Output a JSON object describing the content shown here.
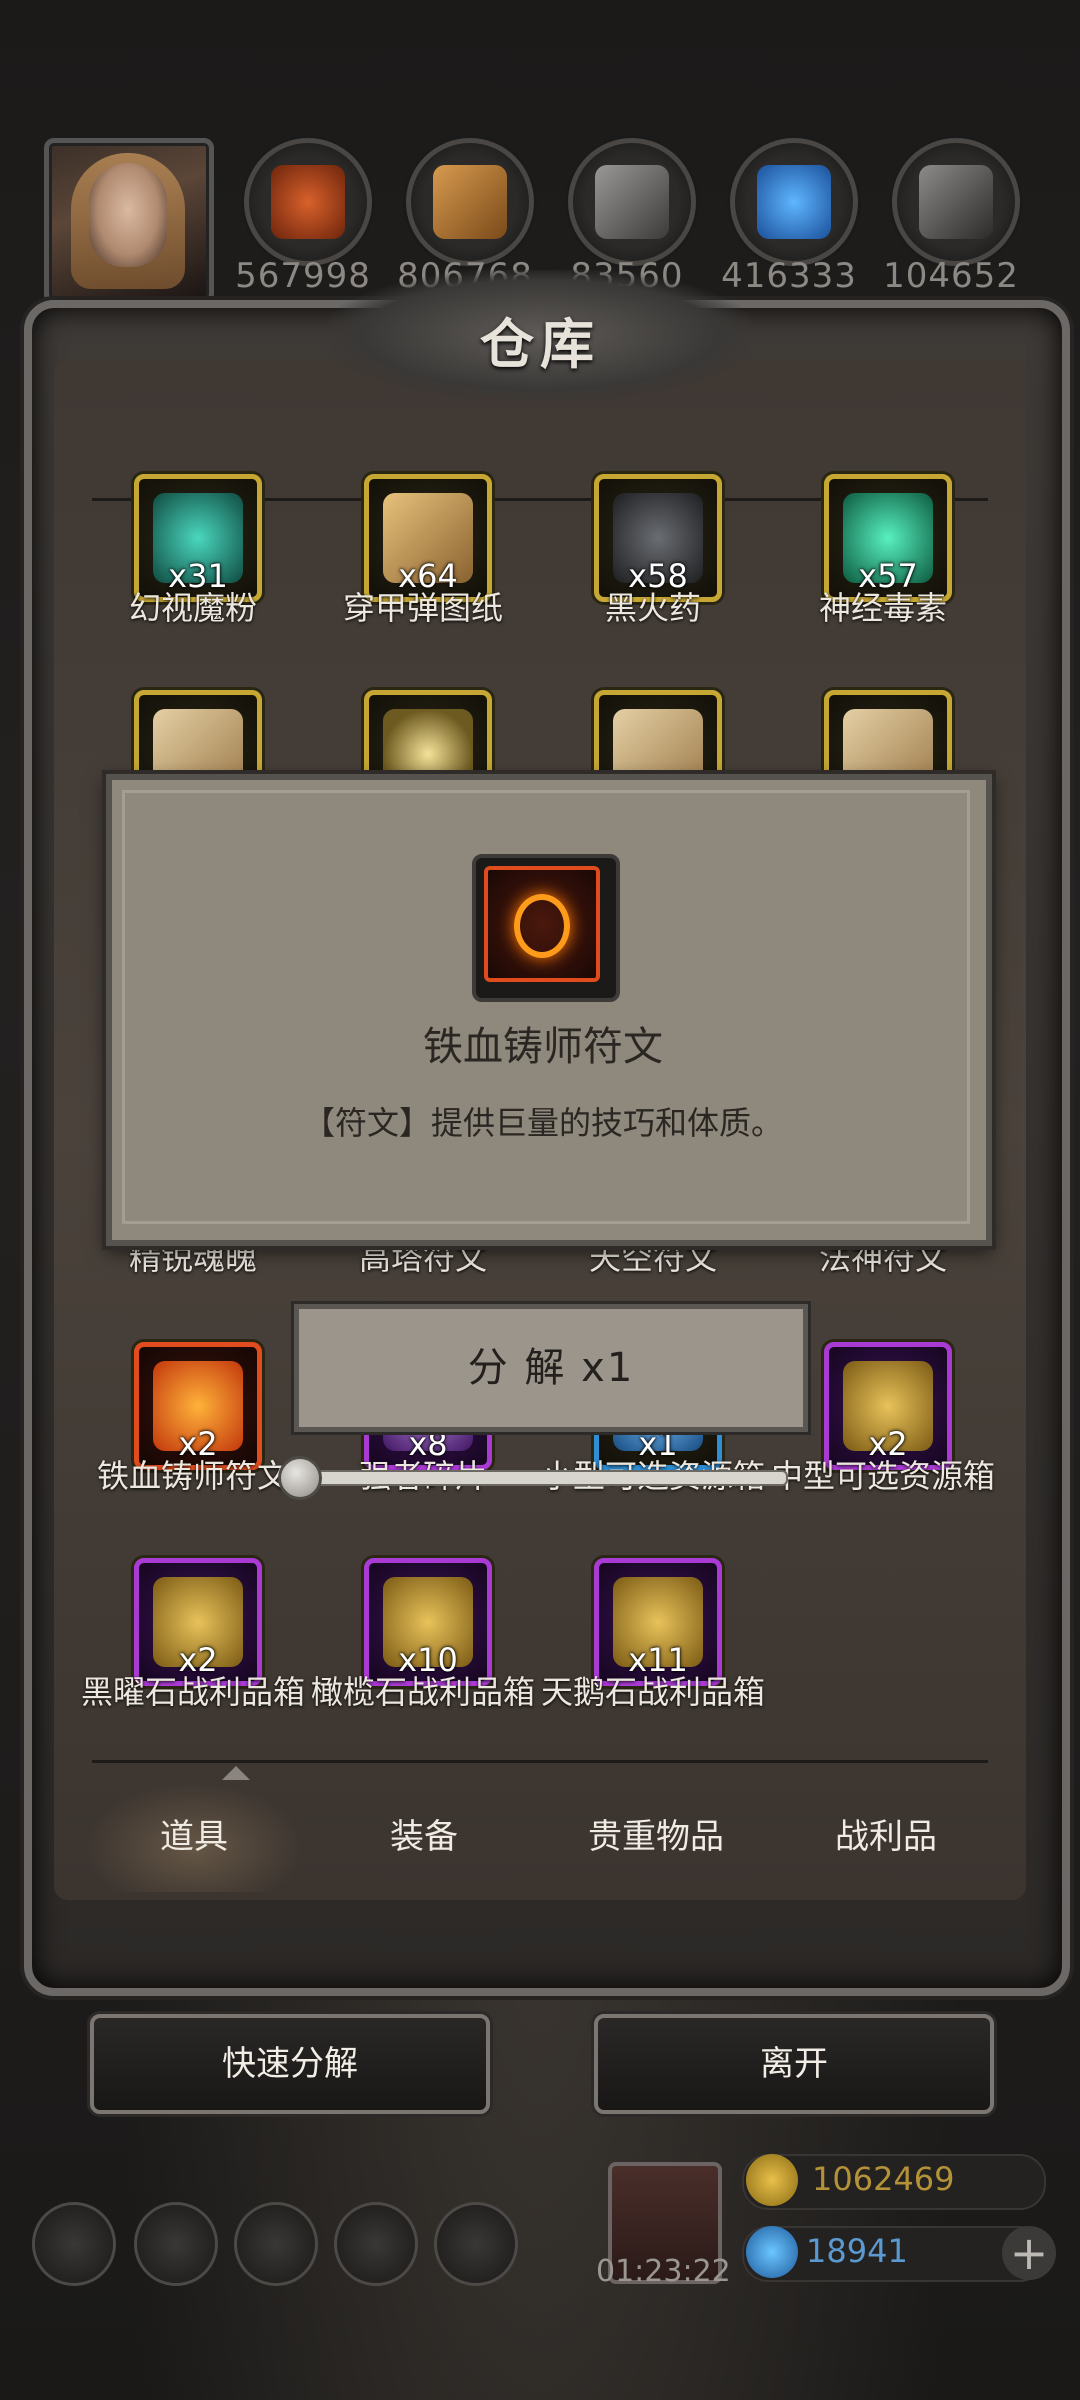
{
  "resources": [
    {
      "name": "resource-1",
      "value": "567998",
      "color": "#c0491e"
    },
    {
      "name": "resource-2",
      "value": "806768",
      "color": "#b9772f"
    },
    {
      "name": "resource-3",
      "value": "83560",
      "color": "#6e6c69"
    },
    {
      "name": "resource-4",
      "value": "416333",
      "color": "#2a77c9"
    },
    {
      "name": "resource-5",
      "value": "104652",
      "color": "#5d5b59"
    }
  ],
  "panel": {
    "title": "仓库"
  },
  "items": [
    {
      "name": "幻视魔粉",
      "qty": "x31",
      "frame": "gold",
      "art": "#3cb7a0"
    },
    {
      "name": "穿甲弹图纸",
      "qty": "x64",
      "frame": "gold",
      "art": "#c9a063"
    },
    {
      "name": "黑火药",
      "qty": "x58",
      "frame": "gold",
      "art": "#3f4145"
    },
    {
      "name": "神经毒素",
      "qty": "x57",
      "frame": "gold",
      "art": "#2fc49a"
    },
    {
      "name": "精锐魂魄",
      "qty": "",
      "frame": "gold",
      "art": "#cbb08a"
    },
    {
      "name": "高塔符文",
      "qty": "",
      "frame": "gold",
      "art": "#e0c46a"
    },
    {
      "name": "天空符文",
      "qty": "",
      "frame": "gold",
      "art": "#cbb08a"
    },
    {
      "name": "法神符文",
      "qty": "",
      "frame": "gold",
      "art": "#cbb08a"
    },
    {
      "name": "铁血铸师符文",
      "qty": "x2",
      "frame": "orange",
      "art": "#ff8a1a"
    },
    {
      "name": "强者碎片",
      "qty": "x8",
      "frame": "purple",
      "art": "#9a62c4"
    },
    {
      "name": "小型可选资源箱",
      "qty": "x1",
      "frame": "blue",
      "art": "#3ea2e0"
    },
    {
      "name": "中型可选资源箱",
      "qty": "x2",
      "frame": "purple",
      "art": "#c49a3a"
    },
    {
      "name": "黑曜石战利品箱",
      "qty": "x2",
      "frame": "purple",
      "art": "#c49a3a"
    },
    {
      "name": "橄榄石战利品箱",
      "qty": "x10",
      "frame": "purple",
      "art": "#c49a3a"
    },
    {
      "name": "天鹅石战利品箱",
      "qty": "x11",
      "frame": "purple",
      "art": "#c49a3a"
    }
  ],
  "tabs": [
    "道具",
    "装备",
    "贵重物品",
    "战利品"
  ],
  "buttons": {
    "quick_decompose": "快速分解",
    "leave": "离开"
  },
  "popup": {
    "title": "铁血铸师符文",
    "description": "【符文】提供巨量的技巧和体质。"
  },
  "decompose": {
    "label": "分 解 x1",
    "slider_fraction": 0.0
  },
  "hud": {
    "timer": "01:23:22",
    "gold": "1062469",
    "gems": "18941",
    "plus": "+",
    "warehouse_label": "仓库"
  }
}
